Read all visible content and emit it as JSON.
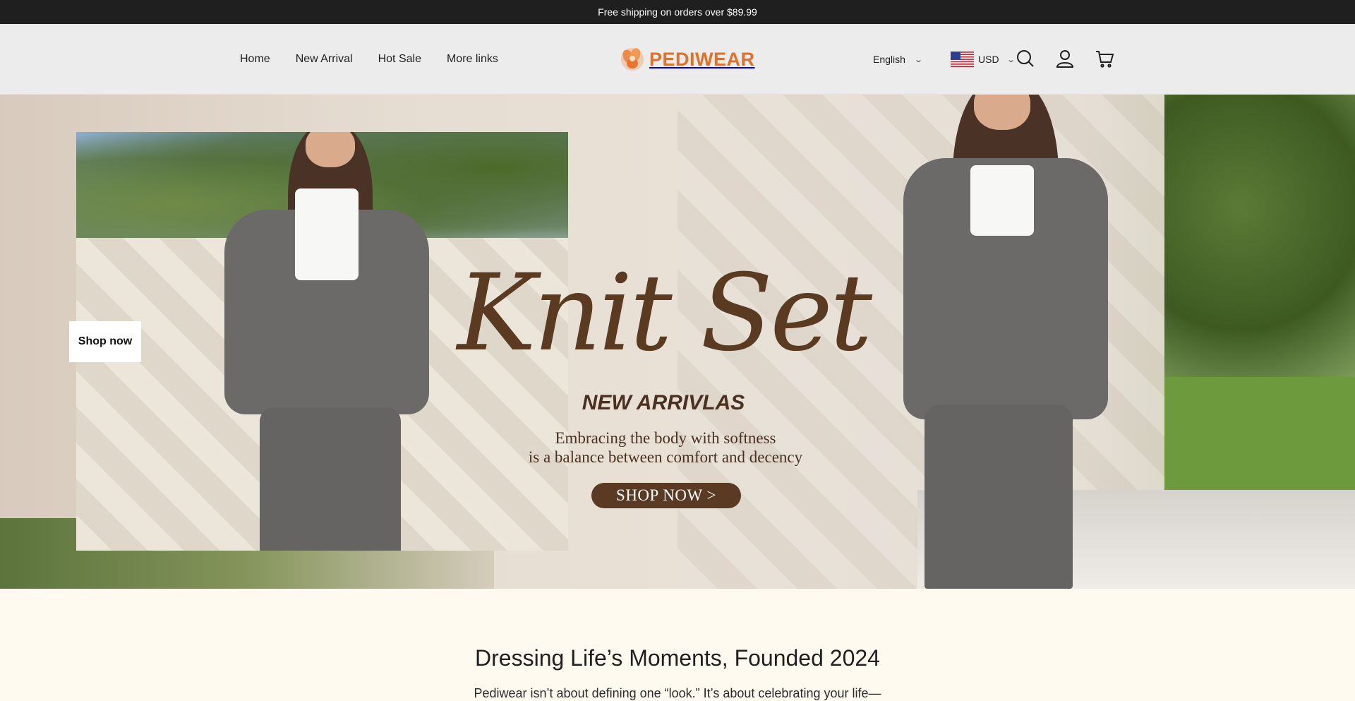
{
  "announcement": {
    "text": "Free shipping on orders over $89.99"
  },
  "header": {
    "nav": [
      {
        "label": "Home"
      },
      {
        "label": "New Arrival"
      },
      {
        "label": "Hot Sale"
      },
      {
        "label": "More links"
      }
    ],
    "logo_text": "PEDIWEAR",
    "language": "English",
    "currency": "USD",
    "icons": [
      "search-icon",
      "account-icon",
      "cart-icon"
    ]
  },
  "hero": {
    "shop_now_label": "Shop now",
    "script_title": "Knit Set",
    "sub_title": "NEW ARRIVLAS",
    "tagline_line1": "Embracing the body with softness",
    "tagline_line2": "is a balance between comfort and decency",
    "cta_label": "SHOP NOW >"
  },
  "about": {
    "heading": "Dressing Life’s Moments, Founded 2024",
    "text": "Pediwear isn’t about defining one “look.” It’s about celebrating your life—"
  },
  "colors": {
    "announcement_bg": "#1f1f1f",
    "header_bg": "#ececec",
    "brand": "#e2702a",
    "hero_text": "#5a3a20",
    "page_bg": "#fffaf0"
  }
}
